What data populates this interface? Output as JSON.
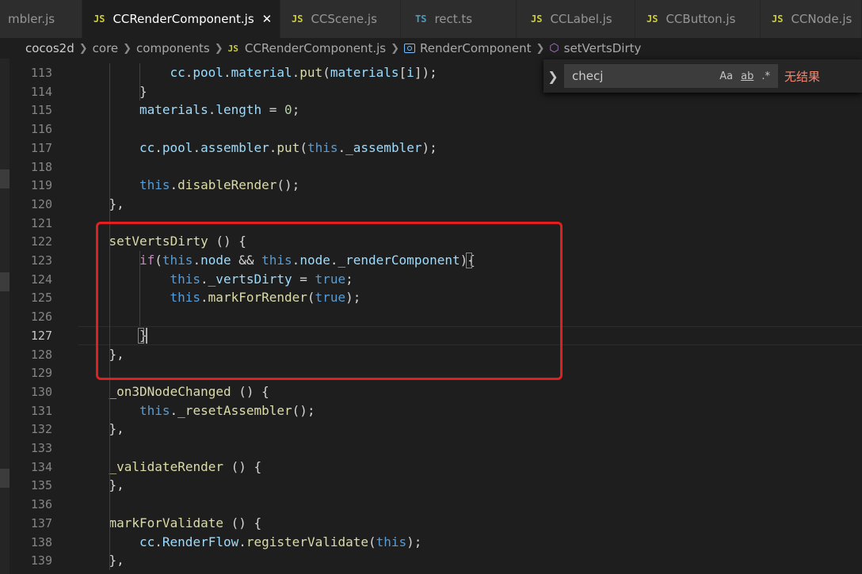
{
  "tabs": [
    {
      "icon": "",
      "label": "mbler.js",
      "active": false
    },
    {
      "icon": "JS",
      "label": "CCRenderComponent.js",
      "active": true,
      "close": "✕"
    },
    {
      "icon": "JS",
      "label": "CCScene.js",
      "active": false
    },
    {
      "icon": "TS",
      "label": "rect.ts",
      "active": false
    },
    {
      "icon": "JS",
      "label": "CCLabel.js",
      "active": false
    },
    {
      "icon": "JS",
      "label": "CCButton.js",
      "active": false
    },
    {
      "icon": "JS",
      "label": "CCNode.js",
      "active": false
    }
  ],
  "breadcrumb": {
    "items": [
      "cocos2d",
      "core",
      "components",
      "CCRenderComponent.js",
      "RenderComponent",
      "setVertsDirty"
    ],
    "file_icon": "JS"
  },
  "find": {
    "toggle": "❯",
    "value": "checj",
    "case_label": "Aa",
    "word_label": "ab",
    "regex_label": ".*",
    "result": "无结果"
  },
  "editor": {
    "current_line": "127",
    "lines": [
      {
        "n": "113",
        "tokens": [
          {
            "t": "cc",
            "c": "prop"
          },
          {
            "t": ".",
            "c": ""
          },
          {
            "t": "pool",
            "c": "prop"
          },
          {
            "t": ".",
            "c": ""
          },
          {
            "t": "material",
            "c": "prop"
          },
          {
            "t": ".",
            "c": ""
          },
          {
            "t": "put",
            "c": "fn"
          },
          {
            "t": "(",
            "c": ""
          },
          {
            "t": "materials",
            "c": "prop"
          },
          {
            "t": "[",
            "c": ""
          },
          {
            "t": "i",
            "c": "prop"
          },
          {
            "t": "]);",
            "c": ""
          }
        ]
      },
      {
        "n": "114",
        "tokens": [
          {
            "t": "}",
            "c": ""
          }
        ]
      },
      {
        "n": "115",
        "tokens": [
          {
            "t": "materials",
            "c": "prop"
          },
          {
            "t": ".",
            "c": ""
          },
          {
            "t": "length",
            "c": "prop"
          },
          {
            "t": " = ",
            "c": ""
          },
          {
            "t": "0",
            "c": "num"
          },
          {
            "t": ";",
            "c": ""
          }
        ]
      },
      {
        "n": "116",
        "tokens": []
      },
      {
        "n": "117",
        "tokens": [
          {
            "t": "cc",
            "c": "prop"
          },
          {
            "t": ".",
            "c": ""
          },
          {
            "t": "pool",
            "c": "prop"
          },
          {
            "t": ".",
            "c": ""
          },
          {
            "t": "assembler",
            "c": "prop"
          },
          {
            "t": ".",
            "c": ""
          },
          {
            "t": "put",
            "c": "fn"
          },
          {
            "t": "(",
            "c": ""
          },
          {
            "t": "this",
            "c": "kw"
          },
          {
            "t": ".",
            "c": ""
          },
          {
            "t": "_assembler",
            "c": "prop"
          },
          {
            "t": ");",
            "c": ""
          }
        ]
      },
      {
        "n": "118",
        "tokens": []
      },
      {
        "n": "119",
        "tokens": [
          {
            "t": "this",
            "c": "kw"
          },
          {
            "t": ".",
            "c": ""
          },
          {
            "t": "disableRender",
            "c": "fn"
          },
          {
            "t": "();",
            "c": ""
          }
        ]
      },
      {
        "n": "120",
        "tokens": [
          {
            "t": "},",
            "c": ""
          }
        ]
      },
      {
        "n": "121",
        "tokens": []
      },
      {
        "n": "122",
        "tokens": [
          {
            "t": "setVertsDirty",
            "c": "fn"
          },
          {
            "t": " () {",
            "c": ""
          }
        ]
      },
      {
        "n": "123",
        "tokens": [
          {
            "t": "if",
            "c": "ctrl"
          },
          {
            "t": "(",
            "c": ""
          },
          {
            "t": "this",
            "c": "kw"
          },
          {
            "t": ".",
            "c": ""
          },
          {
            "t": "node",
            "c": "prop"
          },
          {
            "t": " && ",
            "c": ""
          },
          {
            "t": "this",
            "c": "kw"
          },
          {
            "t": ".",
            "c": ""
          },
          {
            "t": "node",
            "c": "prop"
          },
          {
            "t": ".",
            "c": ""
          },
          {
            "t": "_renderComponent",
            "c": "prop"
          },
          {
            "t": "){",
            "c": ""
          }
        ]
      },
      {
        "n": "124",
        "tokens": [
          {
            "t": "this",
            "c": "kw"
          },
          {
            "t": ".",
            "c": ""
          },
          {
            "t": "_vertsDirty",
            "c": "prop"
          },
          {
            "t": " = ",
            "c": ""
          },
          {
            "t": "true",
            "c": "kw"
          },
          {
            "t": ";",
            "c": ""
          }
        ]
      },
      {
        "n": "125",
        "tokens": [
          {
            "t": "this",
            "c": "kw"
          },
          {
            "t": ".",
            "c": ""
          },
          {
            "t": "markForRender",
            "c": "fn"
          },
          {
            "t": "(",
            "c": ""
          },
          {
            "t": "true",
            "c": "kw"
          },
          {
            "t": ");",
            "c": ""
          }
        ]
      },
      {
        "n": "126",
        "tokens": []
      },
      {
        "n": "127",
        "tokens": [
          {
            "t": "}",
            "c": ""
          }
        ]
      },
      {
        "n": "128",
        "tokens": [
          {
            "t": "},",
            "c": ""
          }
        ]
      },
      {
        "n": "129",
        "tokens": []
      },
      {
        "n": "130",
        "tokens": [
          {
            "t": "_on3DNodeChanged",
            "c": "fn"
          },
          {
            "t": " () {",
            "c": ""
          }
        ]
      },
      {
        "n": "131",
        "tokens": [
          {
            "t": "this",
            "c": "kw"
          },
          {
            "t": ".",
            "c": ""
          },
          {
            "t": "_resetAssembler",
            "c": "fn"
          },
          {
            "t": "();",
            "c": ""
          }
        ]
      },
      {
        "n": "132",
        "tokens": [
          {
            "t": "},",
            "c": ""
          }
        ]
      },
      {
        "n": "133",
        "tokens": []
      },
      {
        "n": "134",
        "tokens": [
          {
            "t": "_validateRender",
            "c": "fn"
          },
          {
            "t": " () {",
            "c": ""
          }
        ]
      },
      {
        "n": "135",
        "tokens": [
          {
            "t": "},",
            "c": ""
          }
        ]
      },
      {
        "n": "136",
        "tokens": []
      },
      {
        "n": "137",
        "tokens": [
          {
            "t": "markForValidate",
            "c": "fn"
          },
          {
            "t": " () {",
            "c": ""
          }
        ]
      },
      {
        "n": "138",
        "tokens": [
          {
            "t": "cc",
            "c": "prop"
          },
          {
            "t": ".",
            "c": ""
          },
          {
            "t": "RenderFlow",
            "c": "prop"
          },
          {
            "t": ".",
            "c": ""
          },
          {
            "t": "registerValidate",
            "c": "fn"
          },
          {
            "t": "(",
            "c": ""
          },
          {
            "t": "this",
            "c": "kw"
          },
          {
            "t": ");",
            "c": ""
          }
        ]
      },
      {
        "n": "139",
        "tokens": [
          {
            "t": "},",
            "c": ""
          }
        ]
      }
    ]
  }
}
